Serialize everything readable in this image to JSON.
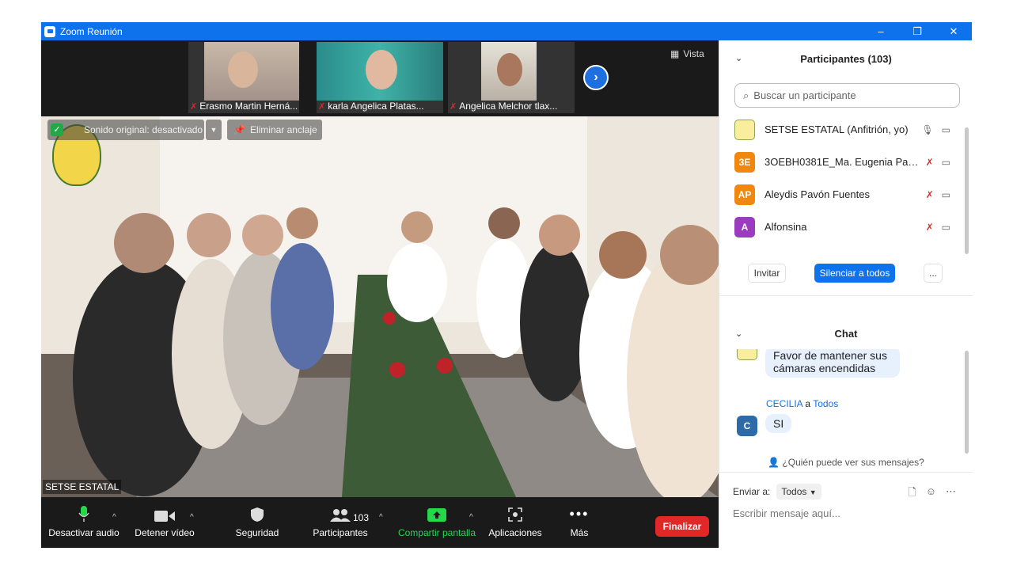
{
  "window": {
    "title": "Zoom Reunión",
    "controls": [
      "–",
      "❐",
      "✕"
    ]
  },
  "strip": {
    "thumbnails": [
      {
        "name": "Erasmo Martin Herná..."
      },
      {
        "name": "karla Angelica  Platas..."
      },
      {
        "name": "Angelica Melchor tlax..."
      }
    ],
    "view_label": "Vista"
  },
  "main": {
    "speaker": "SETSE ESTATAL",
    "original_sound": "Sonido original: desactivado",
    "unpin": "Eliminar anclaje"
  },
  "toolbar": {
    "audio": "Desactivar audio",
    "video": "Detener vídeo",
    "security": "Seguridad",
    "participants": "Participantes",
    "participants_count": "103",
    "share": "Compartir pantalla",
    "apps": "Aplicaciones",
    "more": "Más",
    "end": "Finalizar"
  },
  "participants_panel": {
    "title": "Participantes (103)",
    "search_placeholder": "Buscar un participante",
    "list": [
      {
        "initials": "",
        "name": "SETSE ESTATAL (Anfitrión, yo)",
        "color": "#ffffff",
        "muted": false
      },
      {
        "initials": "3E",
        "name": "3OEBH0381E_Ma. Eugenia Pane...",
        "color": "#f0870e",
        "muted": true
      },
      {
        "initials": "AP",
        "name": "Aleydis Pavón Fuentes",
        "color": "#f0870e",
        "muted": true
      },
      {
        "initials": "A",
        "name": "Alfonsina",
        "color": "#9b3bbf",
        "muted": true
      }
    ],
    "invite": "Invitar",
    "mute_all": "Silenciar a todos",
    "more": "..."
  },
  "chat": {
    "title": "Chat",
    "msg1": "Favor de mantener sus cámaras encendidas",
    "sender": "CECILIA",
    "to_word": "a",
    "recipient": "Todos",
    "sender_initial": "C",
    "msg2": "SI",
    "who_can_see": "¿Quién puede ver sus mensajes?",
    "send_to_label": "Enviar a:",
    "send_to_value": "Todos",
    "input_placeholder": "Escribir mensaje aquí..."
  }
}
